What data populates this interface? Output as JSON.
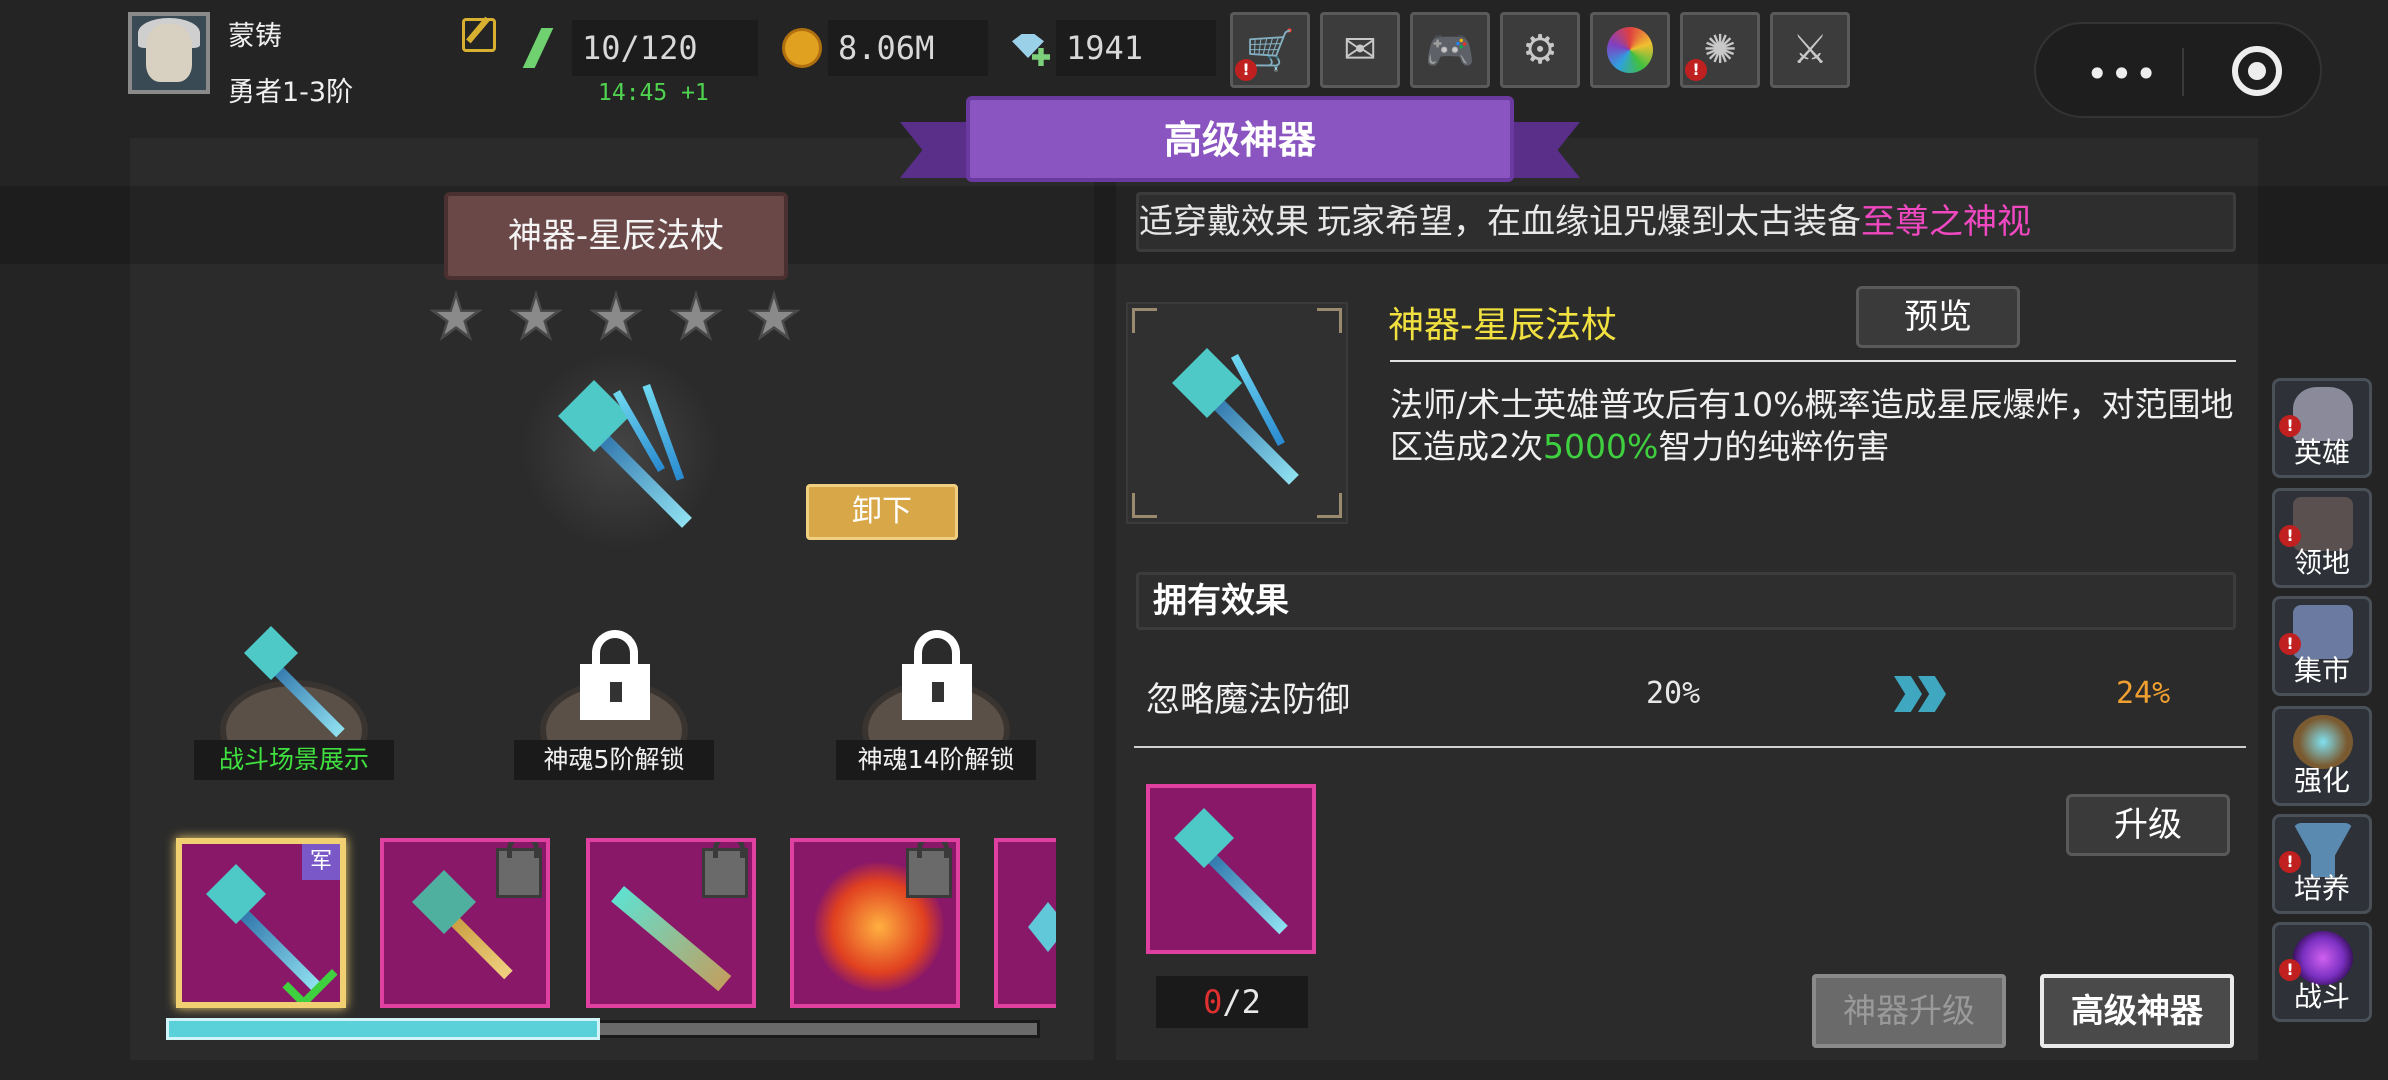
{
  "player": {
    "name": "蒙铸",
    "rank": "勇者1-3阶"
  },
  "resources": {
    "stamina": "10/120",
    "stamina_timer": "14:45 +1",
    "gold": "8.06M",
    "gems": "1941"
  },
  "toolbar": {
    "buttons": [
      {
        "icon": "shop-cart-icon",
        "alert": true
      },
      {
        "icon": "mail-icon",
        "alert": false
      },
      {
        "icon": "gamepad-icon",
        "alert": false
      },
      {
        "icon": "gear-icon",
        "alert": false
      },
      {
        "icon": "color-wheel-icon",
        "alert": false
      },
      {
        "icon": "fireworks-icon",
        "alert": true
      },
      {
        "icon": "crossed-swords-icon",
        "alert": false
      }
    ],
    "alert_mark": "!",
    "menu_dots": "•••"
  },
  "banner": {
    "title": "高级神器"
  },
  "left": {
    "artifact_name": "神器-星辰法杖",
    "stars_total": 5,
    "stars_filled": 0,
    "unequip_label": "卸下",
    "slots": [
      {
        "label": "战斗场景展示",
        "locked": false
      },
      {
        "label": "神魂5阶解锁",
        "locked": true
      },
      {
        "label": "神魂14阶解锁",
        "locked": true
      }
    ],
    "cards": [
      {
        "item": "star-staff",
        "selected": true,
        "locked": false,
        "tag": "军"
      },
      {
        "item": "golden-axe",
        "selected": false,
        "locked": true
      },
      {
        "item": "jade-sword",
        "selected": false,
        "locked": true
      },
      {
        "item": "flame-bow",
        "selected": false,
        "locked": true
      },
      {
        "item": "partial-item",
        "selected": false,
        "locked": false
      }
    ],
    "scroll_progress": 0.5
  },
  "right": {
    "marquee_prefix": "适",
    "marquee_overlay": "穿戴效果",
    "marquee_text": "玩家希望，在血缘诅咒爆到太古装备",
    "marquee_highlight": "至尊之神视",
    "weapon_name": "神器-星辰法杖",
    "preview_label": "预览",
    "desc_part1": "法师/术士英雄普攻后有10%概率造成星辰爆炸，对范围地区造成2次",
    "desc_value": "5000%",
    "desc_part2": "智力的纯粹伤害",
    "own_effect_header": "拥有效果",
    "effect_name": "忽略魔法防御",
    "effect_current": "20%",
    "effect_next": "24%",
    "material_have": "0",
    "material_sep": "/",
    "material_need": "2",
    "upgrade_label": "升级",
    "tab_artifact_upgrade": "神器升级",
    "tab_advanced_artifact": "高级神器"
  },
  "side_nav": [
    {
      "label": "英雄",
      "icon": "helmet-icon",
      "alert": true,
      "color": "#8a8a9a"
    },
    {
      "label": "领地",
      "icon": "castle-icon",
      "alert": true,
      "color": "#5a5050"
    },
    {
      "label": "集市",
      "icon": "market-icon",
      "alert": true,
      "color": "#6a7aa0"
    },
    {
      "label": "强化",
      "icon": "enhance-crystal-icon",
      "alert": false,
      "color": "#7a5a30"
    },
    {
      "label": "培养",
      "icon": "chalice-icon",
      "alert": true,
      "color": "#5a8ab0"
    },
    {
      "label": "战斗",
      "icon": "portal-icon",
      "alert": true,
      "color": "#7a30c0"
    }
  ],
  "colors": {
    "highlight_pink": "#f048c0",
    "value_green": "#3fd03f",
    "next_orange": "#f0a030",
    "weapon_yellow": "#f0e040",
    "card_magenta": "#8a1868",
    "banner_purple": "#8a55c0"
  }
}
